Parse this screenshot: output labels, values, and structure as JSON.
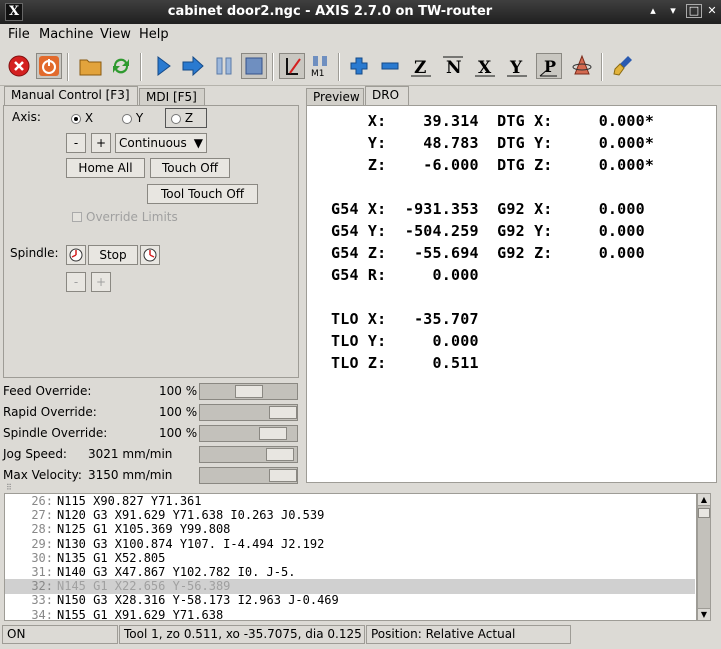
{
  "window": {
    "title": "cabinet door2.ngc - AXIS 2.7.0 on TW-router"
  },
  "menu": [
    "File",
    "Machine",
    "View",
    "Help"
  ],
  "left_tabs": [
    "Manual Control [F3]",
    "MDI [F5]"
  ],
  "right_tabs": [
    "Preview",
    "DRO"
  ],
  "manual": {
    "axis_label": "Axis:",
    "axes": [
      "X",
      "Y",
      "Z"
    ],
    "selected_axis": "Z",
    "minus": "-",
    "plus": "+",
    "jog_mode": "Continuous",
    "home_all": "Home All",
    "touch_off": "Touch Off",
    "tool_touch_off": "Tool Touch Off",
    "override_limits": "Override Limits",
    "spindle_label": "Spindle:",
    "spindle_stop": "Stop"
  },
  "overrides": [
    {
      "label": "Feed Override:",
      "value": "100 %",
      "level": 0.5
    },
    {
      "label": "Rapid Override:",
      "value": "100 %",
      "level": 1.0
    },
    {
      "label": "Spindle Override:",
      "value": "100 %",
      "level": 0.85
    },
    {
      "label": "Jog Speed:",
      "value": "3021 mm/min",
      "level": 0.95
    },
    {
      "label": "Max Velocity:",
      "value": "3150 mm/min",
      "level": 1.0
    }
  ],
  "dro": [
    "    X:    39.314  DTG X:     0.000*",
    "    Y:    48.783  DTG Y:     0.000*",
    "    Z:    -6.000  DTG Z:     0.000*",
    "",
    "G54 X:  -931.353  G92 X:     0.000",
    "G54 Y:  -504.259  G92 Y:     0.000",
    "G54 Z:   -55.694  G92 Z:     0.000",
    "G54 R:     0.000",
    "",
    "TLO X:   -35.707",
    "TLO Y:     0.000",
    "TLO Z:     0.511"
  ],
  "gcode": [
    {
      "num": "26:",
      "text": "N115 X90.827 Y71.361"
    },
    {
      "num": "27:",
      "text": "N120 G3 X91.629 Y71.638 I0.263 J0.539"
    },
    {
      "num": "28:",
      "text": "N125 G1 X105.369 Y99.808"
    },
    {
      "num": "29:",
      "text": "N130 G3 X100.874 Y107. I-4.494 J2.192"
    },
    {
      "num": "30:",
      "text": "N135 G1 X52.805"
    },
    {
      "num": "31:",
      "text": "N140 G3 X47.867 Y102.782 I0. J-5."
    },
    {
      "num": "32:",
      "text": "N145 G1 X22.656 Y-56.389",
      "highlight": true
    },
    {
      "num": "33:",
      "text": "N150 G3 X28.316 Y-58.173 I2.963 J-0.469"
    },
    {
      "num": "34:",
      "text": "N155 G1 X91.629 Y71.638"
    }
  ],
  "status": {
    "state": "ON",
    "tool": "Tool 1, zo 0.511, xo -35.7075, dia 0.125",
    "position": "Position: Relative Actual"
  }
}
